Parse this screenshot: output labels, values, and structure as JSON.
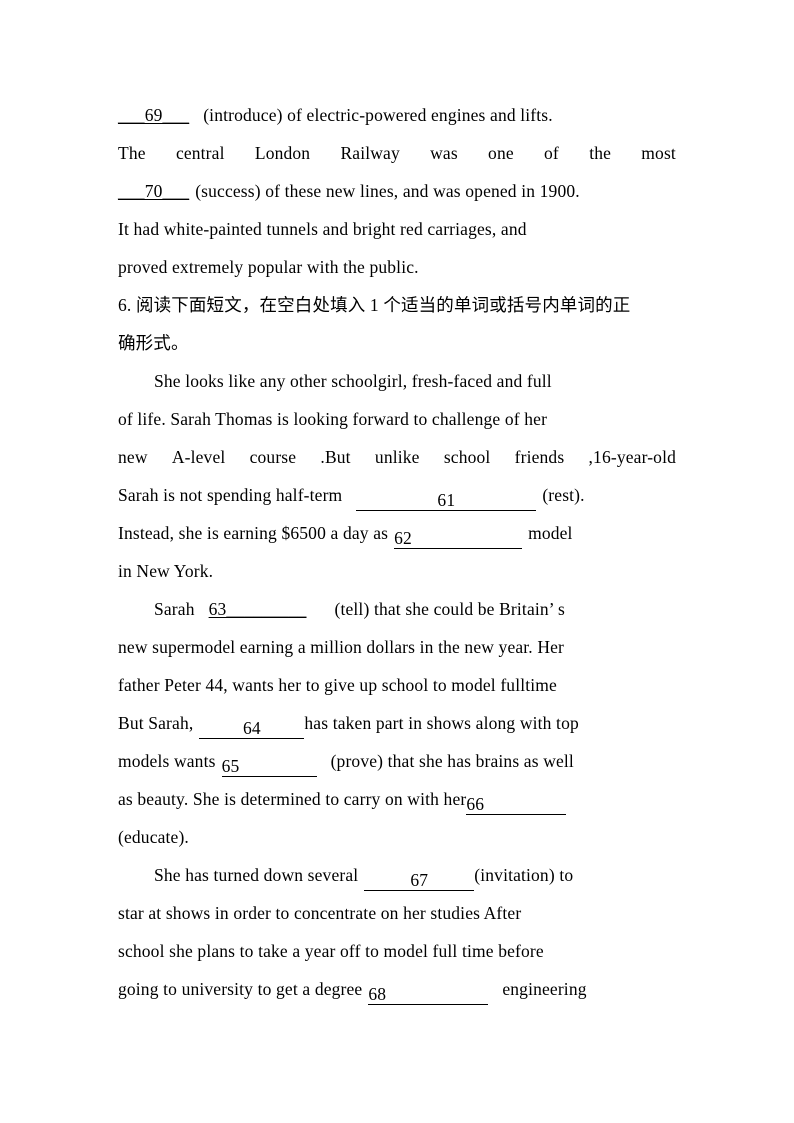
{
  "document": {
    "type": "english-grammar-fill-in-the-blank-worksheet",
    "page_background": "#ffffff",
    "text_color": "#000000"
  },
  "passage1": {
    "line1_blank": "___69___",
    "line1_rest": "(introduce) of electric-powered engines and lifts.",
    "line2_words": [
      "The",
      "central",
      "London",
      "Railway",
      "was",
      "one",
      "of",
      "the",
      "most"
    ],
    "line3_blank": "___70___",
    "line3_rest": "(success) of these new lines, and was opened in 1900.",
    "line4": "It had white-painted tunnels and bright red carriages, and",
    "line5": "proved extremely popular with the public."
  },
  "instruction": {
    "line1": "6. 阅读下面短文，在空白处填入 1 个适当的单词或括号内单词的正",
    "line2": "确形式。"
  },
  "passage2": {
    "p1": {
      "line1": "She looks like any other schoolgirl, fresh-faced and full",
      "line2": "of life. Sarah Thomas is looking forward to challenge of her",
      "line3_words": [
        "new",
        "A-level",
        "course",
        ".But",
        "unlike",
        "school",
        "friends",
        ",16-year-old"
      ],
      "line4_pre": "Sarah is not spending half-term",
      "line4_blank": "61",
      "line4_post": "(rest).",
      "line5_pre": "Instead, she is earning $6500 a day as",
      "line5_blank": "62",
      "line5_post": "model",
      "line6": "in New York."
    },
    "p2": {
      "line1_pre": "Sarah",
      "line1_blank": "63_________",
      "line1_post": "(tell) that she could be Britain’ s",
      "line2": "new supermodel earning a million dollars in the new year. Her",
      "line3": "father Peter 44, wants her to give up school to model fulltime",
      "line4_pre": "But Sarah,",
      "line4_blank": "64",
      "line4_post": "has taken part in shows along with top",
      "line5_pre": "models wants",
      "line5_blank": "65",
      "line5_post": "(prove) that she has brains as well",
      "line6_pre": "as beauty. She is determined to carry on with her",
      "line6_blank": "66",
      "line7": "(educate)."
    },
    "p3": {
      "line1_pre": "She has turned down several",
      "line1_blank": "67",
      "line1_post": "(invitation) to",
      "line2": "star at shows in order to concentrate on her studies After",
      "line3": "school she plans to take a year off to model full time before",
      "line4_pre": "going to university to get a degree",
      "line4_blank": "68",
      "line4_post": "engineering"
    }
  }
}
